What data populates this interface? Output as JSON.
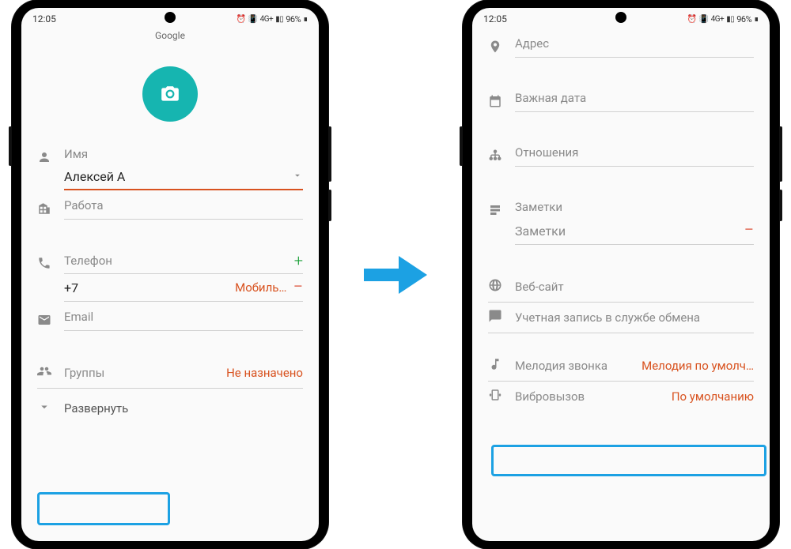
{
  "status": {
    "time": "12:05",
    "battery": "96%"
  },
  "left": {
    "account": "Google",
    "name_label": "Имя",
    "name_value": "Алексей А",
    "work_label": "Работа",
    "phone_label": "Телефон",
    "phone_value": "+7",
    "phone_type": "Мобиль…",
    "email_label": "Email",
    "groups_label": "Группы",
    "groups_value": "Не назначено",
    "expand": "Развернуть"
  },
  "right": {
    "address_label": "Адрес",
    "date_label": "Важная дата",
    "relations_label": "Отношения",
    "notes_label": "Заметки",
    "notes_value": "Заметки",
    "website_label": "Веб-сайт",
    "exchange_label": "Учетная запись в службе обмена",
    "ringtone_label": "Мелодия звонка",
    "ringtone_value": "Мелодия по умолч…",
    "vibration_label": "Вибровызов",
    "vibration_value": "По умолчанию"
  }
}
